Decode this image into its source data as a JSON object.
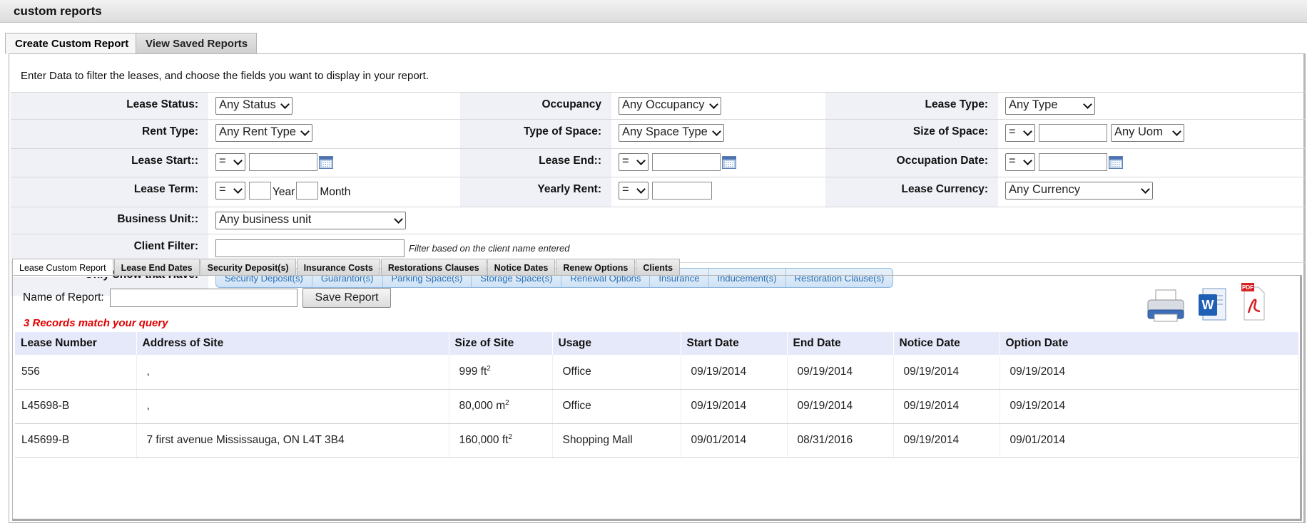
{
  "header": {
    "title": "custom reports"
  },
  "main_tabs": [
    {
      "label": "Create Custom Report",
      "active": true
    },
    {
      "label": "View Saved Reports",
      "active": false
    }
  ],
  "intro": "Enter Data to filter the leases, and choose the fields you want to display in your report.",
  "filters": {
    "lease_status": {
      "label": "Lease Status:",
      "value": "Any Status"
    },
    "occupancy": {
      "label": "Occupancy",
      "value": "Any Occupancy"
    },
    "lease_type": {
      "label": "Lease Type:",
      "value": "Any Type"
    },
    "rent_type": {
      "label": "Rent Type:",
      "value": "Any Rent Type"
    },
    "type_of_space": {
      "label": "Type of Space:",
      "value": "Any Space Type"
    },
    "size_of_space": {
      "label": "Size of Space:",
      "op": "=",
      "value": "",
      "uom": "Any Uom"
    },
    "lease_start": {
      "label": "Lease Start::",
      "op": "=",
      "value": ""
    },
    "lease_end": {
      "label": "Lease End::",
      "op": "=",
      "value": ""
    },
    "occupation_date": {
      "label": "Occupation Date:",
      "op": "=",
      "value": ""
    },
    "lease_term": {
      "label": "Lease Term:",
      "op": "=",
      "year_label": "Year",
      "month_label": "Month"
    },
    "yearly_rent": {
      "label": "Yearly Rent:",
      "op": "=",
      "value": ""
    },
    "lease_currency": {
      "label": "Lease Currency:",
      "value": "Any Currency"
    },
    "business_unit": {
      "label": "Business Unit::",
      "value": "Any business unit"
    },
    "client_filter": {
      "label": "Client Filter:",
      "value": "",
      "hint": "Filter based on the client name entered"
    },
    "only_show": {
      "label": "Only Show that Have:",
      "options": [
        "Security Deposit(s)",
        "Guarantor(s)",
        "Parking Space(s)",
        "Storage Space(s)",
        "Renewal Options",
        "Insurance",
        "Inducement(s)",
        "Restoration Clause(s)"
      ]
    }
  },
  "sub_tabs": [
    "Lease Custom Report",
    "Lease End Dates",
    "Security Deposit(s)",
    "Insurance Costs",
    "Restorations Clauses",
    "Notice Dates",
    "Renew Options",
    "Clients"
  ],
  "report": {
    "name_label": "Name of Report:",
    "name_value": "",
    "save_label": "Save Report",
    "records_message": "3 Records match your query",
    "export_icons": [
      "printer-icon",
      "word-icon",
      "pdf-icon"
    ]
  },
  "table": {
    "columns": [
      "Lease Number",
      "Address of Site",
      "Size of Site",
      "Usage",
      "Start Date",
      "End Date",
      "Notice Date",
      "Option Date"
    ],
    "rows": [
      {
        "lease_number": "556",
        "address": ",",
        "size": "999 ft",
        "size_sup": "2",
        "usage": "Office",
        "start": "09/19/2014",
        "end": "09/19/2014",
        "notice": "09/19/2014",
        "option": "09/19/2014"
      },
      {
        "lease_number": "L45698-B",
        "address": ",",
        "size": "80,000 m",
        "size_sup": "2",
        "usage": "Office",
        "start": "09/19/2014",
        "end": "09/19/2014",
        "notice": "09/19/2014",
        "option": "09/19/2014"
      },
      {
        "lease_number": "L45699-B",
        "address": "7 first avenue Mississauga, ON L4T 3B4",
        "size": "160,000 ft",
        "size_sup": "2",
        "usage": "Shopping Mall",
        "start": "09/01/2014",
        "end": "08/31/2016",
        "notice": "09/19/2014",
        "option": "09/01/2014"
      }
    ]
  }
}
